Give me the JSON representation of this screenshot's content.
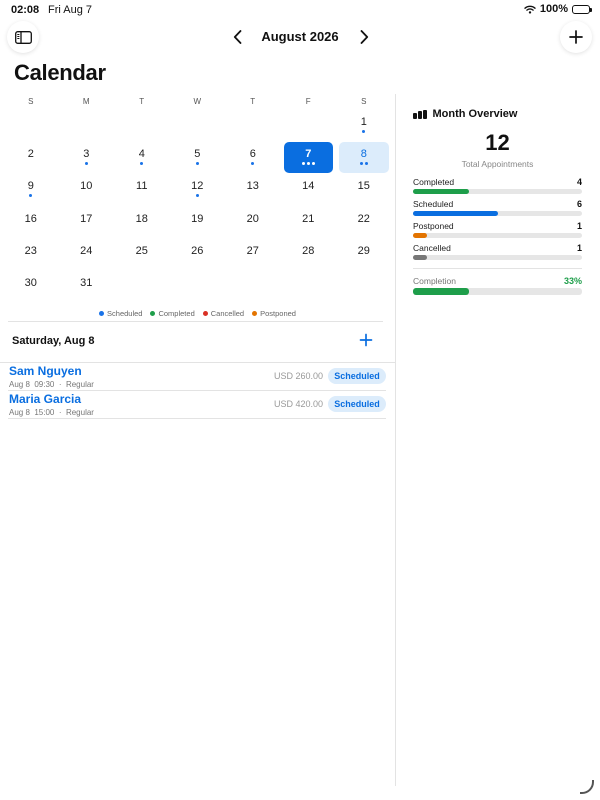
{
  "status_bar": {
    "time": "02:08",
    "date": "Fri Aug 7",
    "battery": "100%"
  },
  "header": {
    "month": "August 2026",
    "title": "Calendar"
  },
  "calendar": {
    "weekdays": [
      "S",
      "M",
      "T",
      "W",
      "T",
      "F",
      "S"
    ],
    "leading_blanks": 6,
    "selected_day": 7,
    "highlighted_day": 8,
    "days": [
      {
        "n": "1",
        "dots": 1
      },
      {
        "n": "2",
        "dots": 0
      },
      {
        "n": "3",
        "dots": 1
      },
      {
        "n": "4",
        "dots": 1
      },
      {
        "n": "5",
        "dots": 1
      },
      {
        "n": "6",
        "dots": 1
      },
      {
        "n": "7",
        "dots": 3
      },
      {
        "n": "8",
        "dots": 2
      },
      {
        "n": "9",
        "dots": 1
      },
      {
        "n": "10",
        "dots": 0
      },
      {
        "n": "11",
        "dots": 0
      },
      {
        "n": "12",
        "dots": 1
      },
      {
        "n": "13",
        "dots": 0
      },
      {
        "n": "14",
        "dots": 0
      },
      {
        "n": "15",
        "dots": 0
      },
      {
        "n": "16",
        "dots": 0
      },
      {
        "n": "17",
        "dots": 0
      },
      {
        "n": "18",
        "dots": 0
      },
      {
        "n": "19",
        "dots": 0
      },
      {
        "n": "20",
        "dots": 0
      },
      {
        "n": "21",
        "dots": 0
      },
      {
        "n": "22",
        "dots": 0
      },
      {
        "n": "23",
        "dots": 0
      },
      {
        "n": "24",
        "dots": 0
      },
      {
        "n": "25",
        "dots": 0
      },
      {
        "n": "26",
        "dots": 0
      },
      {
        "n": "27",
        "dots": 0
      },
      {
        "n": "28",
        "dots": 0
      },
      {
        "n": "29",
        "dots": 0
      },
      {
        "n": "30",
        "dots": 0
      },
      {
        "n": "31",
        "dots": 0
      }
    ],
    "dot_color": "#1a73e8"
  },
  "legend": [
    {
      "label": "Scheduled",
      "color": "#1a73e8"
    },
    {
      "label": "Completed",
      "color": "#1e9e4a"
    },
    {
      "label": "Cancelled",
      "color": "#d93025"
    },
    {
      "label": "Postponed",
      "color": "#e37400"
    }
  ],
  "day_detail": {
    "title": "Saturday, Aug 8",
    "appointments": [
      {
        "name": "Sam Nguyen",
        "date": "Aug 8",
        "time": "09:30",
        "type": "Regular",
        "price": "USD 260.00",
        "status": "Scheduled"
      },
      {
        "name": "Maria Garcia",
        "date": "Aug 8",
        "time": "15:00",
        "type": "Regular",
        "price": "USD 420.00",
        "status": "Scheduled"
      }
    ]
  },
  "overview": {
    "title": "Month Overview",
    "total": "12",
    "total_label": "Total Appointments",
    "stats": [
      {
        "label": "Completed",
        "value": "4",
        "fraction": 0.333,
        "color": "#1e9e4a"
      },
      {
        "label": "Scheduled",
        "value": "6",
        "fraction": 0.5,
        "color": "#0a6ee0"
      },
      {
        "label": "Postponed",
        "value": "1",
        "fraction": 0.083,
        "color": "#e37400"
      },
      {
        "label": "Cancelled",
        "value": "1",
        "fraction": 0.083,
        "color": "#777777"
      }
    ],
    "completion": {
      "label": "Completion",
      "value": "33%",
      "fraction": 0.33,
      "color": "#1e9e4a"
    }
  }
}
